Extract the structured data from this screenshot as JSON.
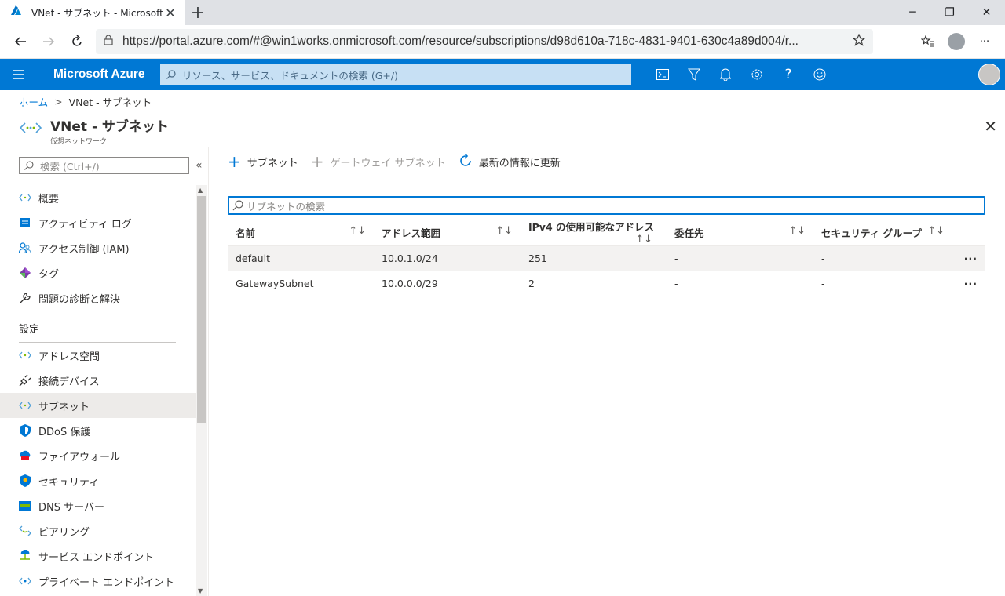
{
  "browser": {
    "tab_title": "VNet - サブネット - Microsoft Azure",
    "url": "https://portal.azure.com/#@win1works.onmicrosoft.com/resource/subscriptions/d98d610a-718c-4831-9401-630c4a89d004/r..."
  },
  "azure": {
    "brand": "Microsoft Azure",
    "search_placeholder": "リソース、サービス、ドキュメントの検索 (G+/)"
  },
  "breadcrumb": {
    "home": "ホーム",
    "current": "VNet - サブネット"
  },
  "page": {
    "title": "VNet - サブネット",
    "subtitle": "仮想ネットワーク"
  },
  "sidebar": {
    "search_placeholder": "検索 (Ctrl+/)",
    "items_top": [
      {
        "label": "概要",
        "icon": "overview-icon"
      },
      {
        "label": "アクティビティ ログ",
        "icon": "activity-log-icon"
      },
      {
        "label": "アクセス制御 (IAM)",
        "icon": "iam-icon"
      },
      {
        "label": "タグ",
        "icon": "tag-icon"
      },
      {
        "label": "問題の診断と解決",
        "icon": "wrench-icon"
      }
    ],
    "section_settings": "設定",
    "items_settings": [
      {
        "label": "アドレス空間",
        "icon": "address-space-icon"
      },
      {
        "label": "接続デバイス",
        "icon": "plug-icon"
      },
      {
        "label": "サブネット",
        "icon": "subnet-icon"
      },
      {
        "label": "DDoS 保護",
        "icon": "ddos-shield-icon"
      },
      {
        "label": "ファイアウォール",
        "icon": "firewall-icon"
      },
      {
        "label": "セキュリティ",
        "icon": "security-shield-icon"
      },
      {
        "label": "DNS サーバー",
        "icon": "dns-icon"
      },
      {
        "label": "ピアリング",
        "icon": "peering-icon"
      },
      {
        "label": "サービス エンドポイント",
        "icon": "service-endpoint-icon"
      },
      {
        "label": "プライベート エンドポイント",
        "icon": "private-endpoint-icon"
      }
    ]
  },
  "commands": {
    "add_subnet": "サブネット",
    "add_gateway_subnet": "ゲートウェイ サブネット",
    "refresh": "最新の情報に更新"
  },
  "filter_placeholder": "サブネットの検索",
  "table": {
    "headers": [
      "名前",
      "アドレス範囲",
      "IPv4 の使用可能なアドレス",
      "委任先",
      "セキュリティ グループ"
    ],
    "rows": [
      {
        "name": "default",
        "range": "10.0.1.0/24",
        "available": "251",
        "delegated": "-",
        "nsg": "-"
      },
      {
        "name": "GatewaySubnet",
        "range": "10.0.0.0/29",
        "available": "2",
        "delegated": "-",
        "nsg": "-"
      }
    ]
  },
  "colors": {
    "azure_blue": "#0078d4",
    "search_bg": "#c7e0f4"
  }
}
